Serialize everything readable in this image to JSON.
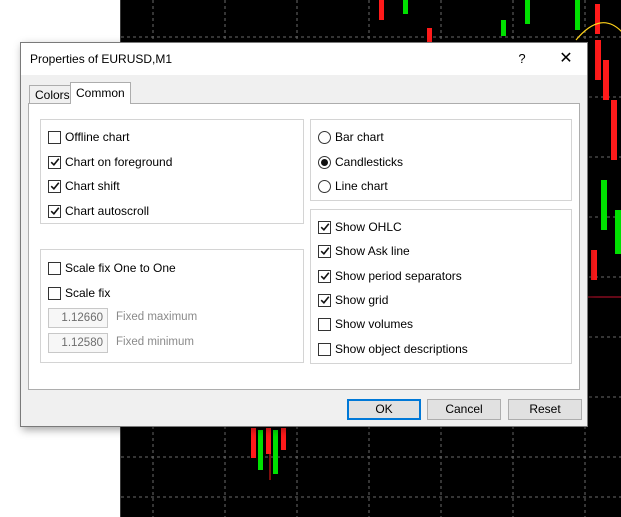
{
  "dialog": {
    "title": "Properties of EURUSD,M1",
    "help_label": "?",
    "close_label": "✕"
  },
  "tabs": [
    {
      "label": "Colors",
      "active": false
    },
    {
      "label": "Common",
      "active": true
    }
  ],
  "chart_options": [
    {
      "label": "Offline chart",
      "checked": false
    },
    {
      "label": "Chart on foreground",
      "checked": true
    },
    {
      "label": "Chart shift",
      "checked": true
    },
    {
      "label": "Chart autoscroll",
      "checked": true
    }
  ],
  "scale_options": [
    {
      "label": "Scale fix One to One",
      "checked": false
    },
    {
      "label": "Scale fix",
      "checked": false
    }
  ],
  "fixed_maximum": {
    "value": "1.12660",
    "label": "Fixed maximum"
  },
  "fixed_minimum": {
    "value": "1.12580",
    "label": "Fixed minimum"
  },
  "chart_type": {
    "options": [
      "Bar chart",
      "Candlesticks",
      "Line chart"
    ],
    "selected": "Candlesticks"
  },
  "show_options": [
    {
      "label": "Show OHLC",
      "checked": true
    },
    {
      "label": "Show Ask line",
      "checked": true
    },
    {
      "label": "Show period separators",
      "checked": true
    },
    {
      "label": "Show grid",
      "checked": true
    },
    {
      "label": "Show volumes",
      "checked": false
    },
    {
      "label": "Show object descriptions",
      "checked": false
    }
  ],
  "buttons": {
    "ok": "OK",
    "cancel": "Cancel",
    "reset": "Reset"
  },
  "colors": {
    "chart_background": "#000000",
    "bull_candle": "#00e000",
    "bear_candle": "#ff1a1a",
    "grid": "#5a5a5a",
    "focus": "#0078d7"
  }
}
